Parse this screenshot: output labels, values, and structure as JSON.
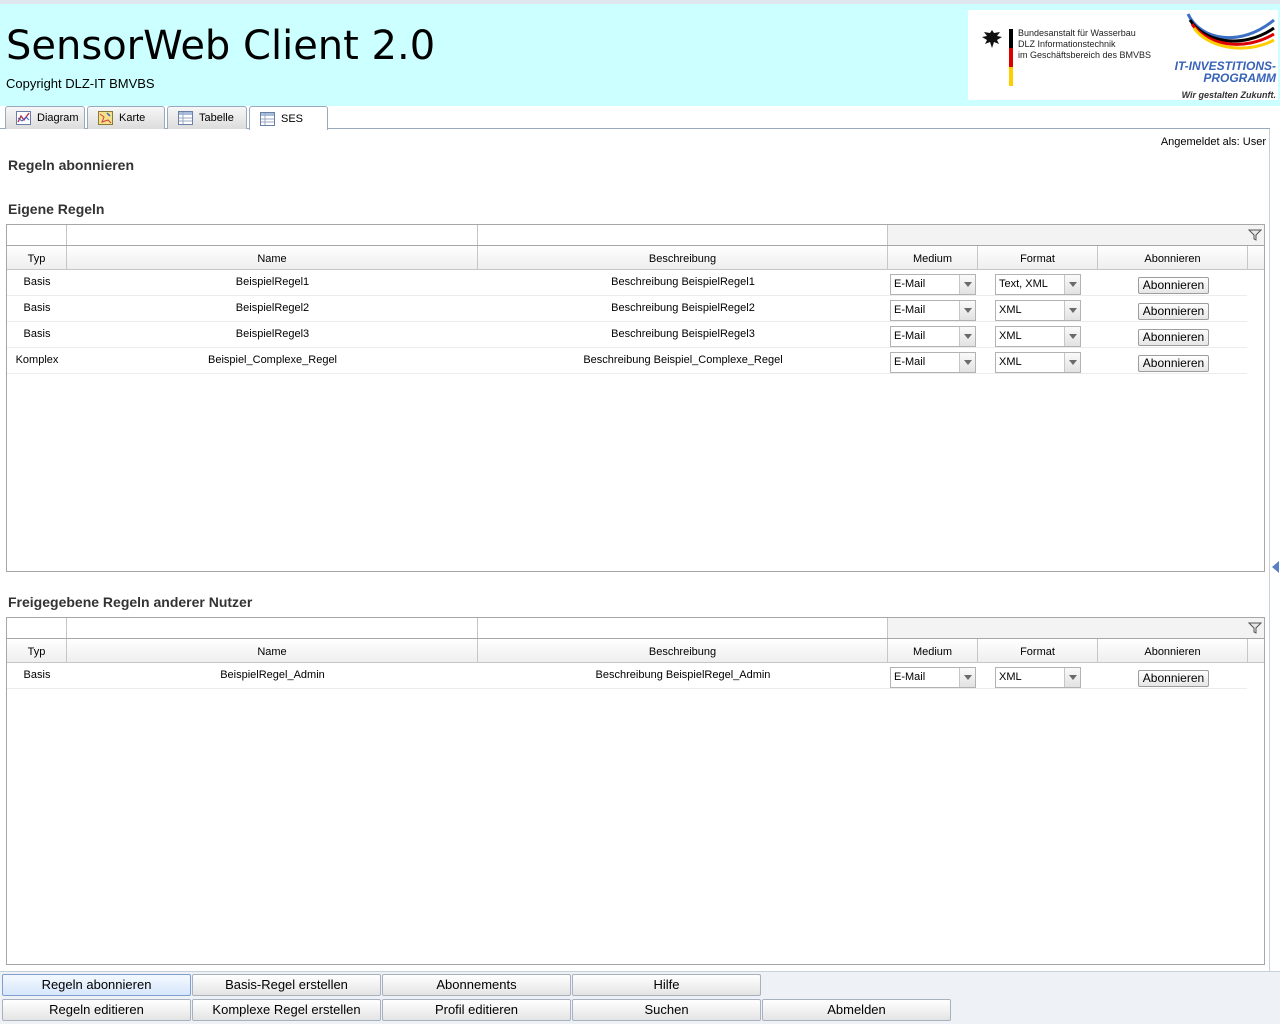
{
  "header": {
    "title": "SensorWeb Client 2.0",
    "copyright": "Copyright DLZ-IT BMVBS",
    "logo_agency": [
      "Bundesanstalt für Wasserbau",
      "DLZ  Informationstechnik",
      "im Geschäftsbereich des BMVBS"
    ],
    "logo_program_line1": "IT-INVESTITIONS-",
    "logo_program_line2": "PROGRAMM",
    "logo_claim": "Wir gestalten Zukunft."
  },
  "tabs": [
    {
      "label": "Diagram",
      "icon": "chart-icon",
      "active": false
    },
    {
      "label": "Karte",
      "icon": "map-icon",
      "active": false
    },
    {
      "label": "Tabelle",
      "icon": "table-icon",
      "active": false
    },
    {
      "label": "SES",
      "icon": "table-icon",
      "active": true
    }
  ],
  "session": {
    "logged_in_as": "Angemeldet als: User"
  },
  "page": {
    "title": "Regeln abonnieren"
  },
  "columns": [
    "Typ",
    "Name",
    "Beschreibung",
    "Medium",
    "Format",
    "Abonnieren"
  ],
  "own_rules": {
    "title": "Eigene Regeln",
    "rows": [
      {
        "typ": "Basis",
        "name": "BeispielRegel1",
        "beschreibung": "Beschreibung BeispielRegel1",
        "medium": "E-Mail",
        "format": "Text, XML",
        "button": "Abonnieren"
      },
      {
        "typ": "Basis",
        "name": "BeispielRegel2",
        "beschreibung": "Beschreibung BeispielRegel2",
        "medium": "E-Mail",
        "format": "XML",
        "button": "Abonnieren"
      },
      {
        "typ": "Basis",
        "name": "BeispielRegel3",
        "beschreibung": "Beschreibung BeispielRegel3",
        "medium": "E-Mail",
        "format": "XML",
        "button": "Abonnieren"
      },
      {
        "typ": "Komplex",
        "name": "Beispiel_Complexe_Regel",
        "beschreibung": "Beschreibung Beispiel_Complexe_Regel",
        "medium": "E-Mail",
        "format": "XML",
        "button": "Abonnieren"
      }
    ]
  },
  "shared_rules": {
    "title": "Freigegebene Regeln anderer Nutzer",
    "rows": [
      {
        "typ": "Basis",
        "name": "BeispielRegel_Admin",
        "beschreibung": "Beschreibung BeispielRegel_Admin",
        "medium": "E-Mail",
        "format": "XML",
        "button": "Abonnieren"
      }
    ]
  },
  "nav": {
    "row1": [
      {
        "label": "Regeln abonnieren",
        "active": true
      },
      {
        "label": "Basis-Regel erstellen",
        "active": false
      },
      {
        "label": "Abonnements",
        "active": false
      },
      {
        "label": "Hilfe",
        "active": false
      }
    ],
    "row2": [
      {
        "label": "Regeln editieren",
        "active": false
      },
      {
        "label": "Komplexe Regel erstellen",
        "active": false
      },
      {
        "label": "Profil editieren",
        "active": false
      },
      {
        "label": "Suchen",
        "active": false
      },
      {
        "label": "Abmelden",
        "active": false
      }
    ]
  },
  "colors": {
    "header_bg": "#ccffff",
    "accent_blue": "#3763b8"
  }
}
